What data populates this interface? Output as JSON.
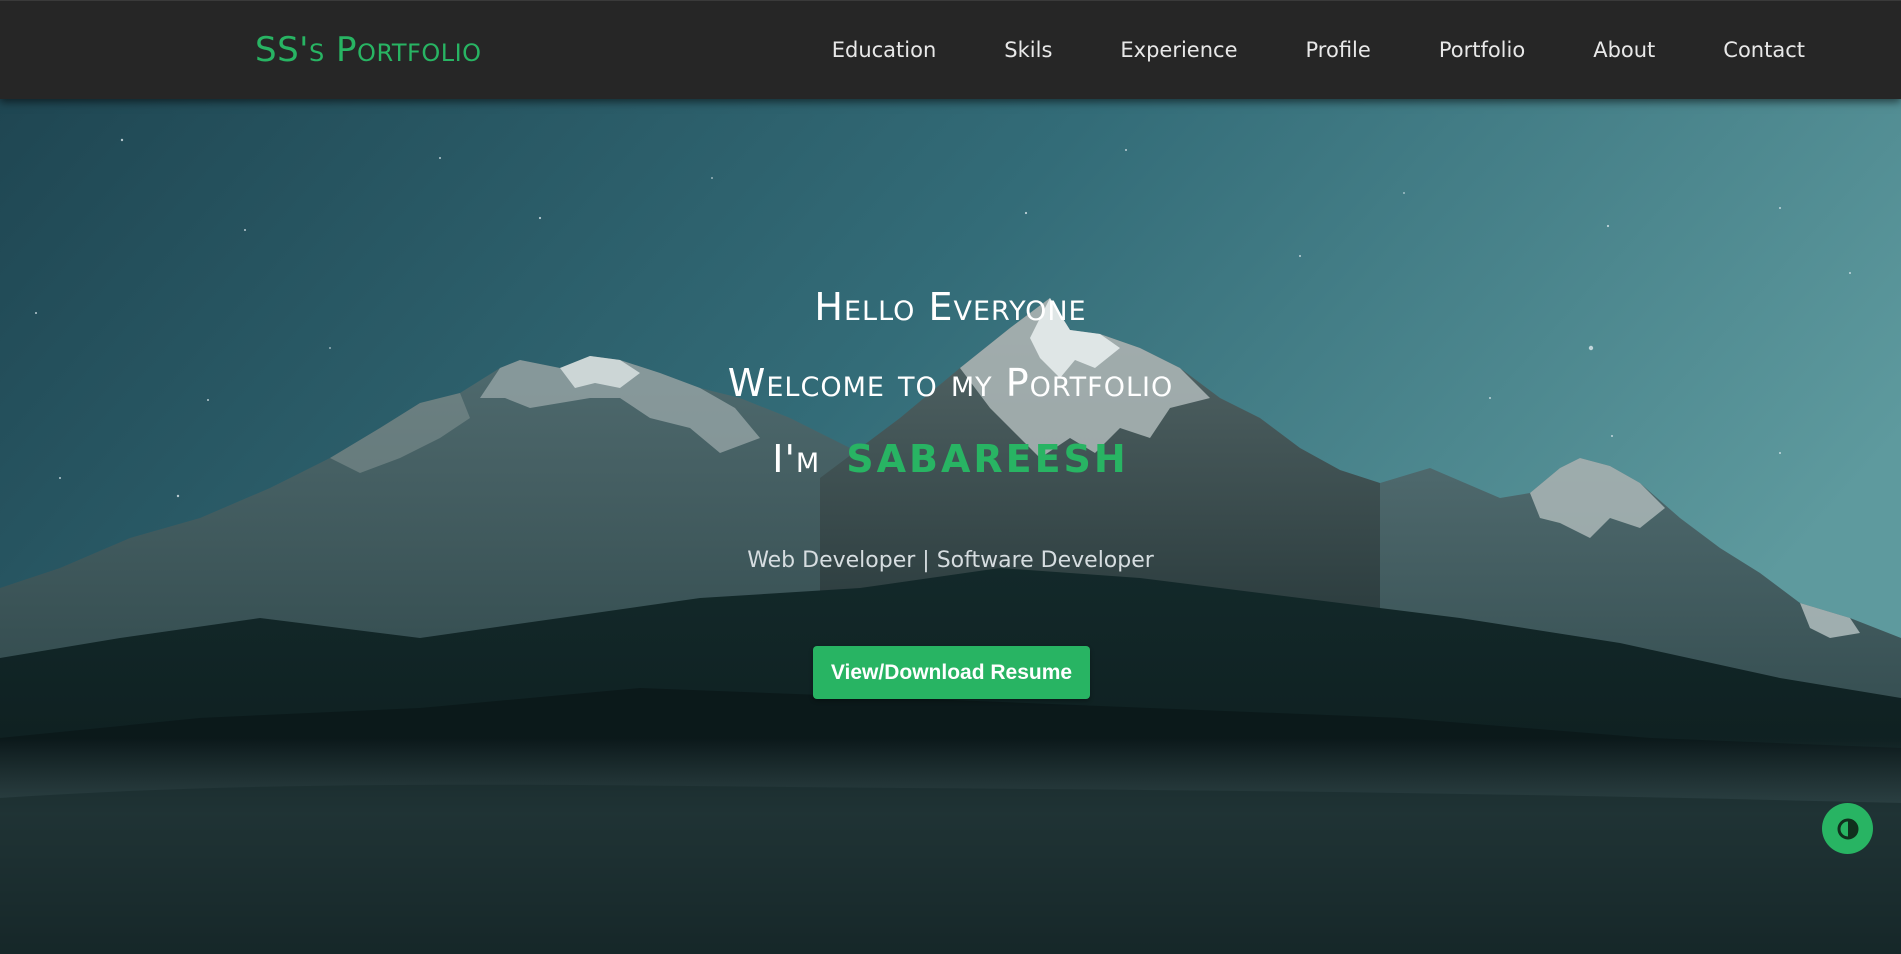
{
  "navbar": {
    "brand": "SS's Portfolio",
    "links": [
      {
        "label": "Education"
      },
      {
        "label": "Skils"
      },
      {
        "label": "Experience"
      },
      {
        "label": "Profile"
      },
      {
        "label": "Portfolio"
      },
      {
        "label": "About"
      },
      {
        "label": "Contact"
      }
    ]
  },
  "hero": {
    "greeting": "Hello Everyone",
    "welcome": "Welcome to my Portfolio",
    "intro_prefix": "I'm",
    "name": "SABAREESH",
    "roles": "Web Developer | Software Developer",
    "resume_button": "View/Download Resume"
  },
  "theme_toggle": {
    "icon": "contrast-icon"
  },
  "colors": {
    "accent": "#28b463",
    "navbar_bg": "#262626",
    "nav_text": "#e8e8e8"
  }
}
